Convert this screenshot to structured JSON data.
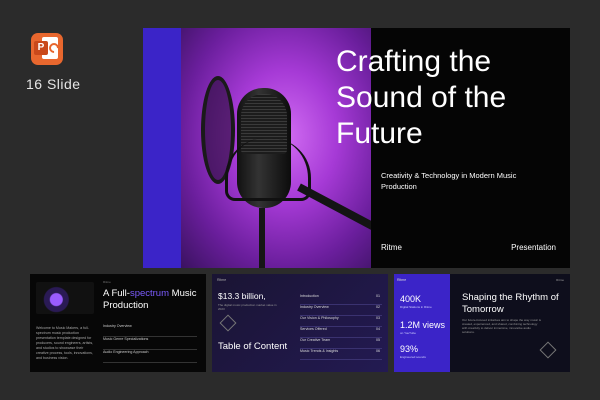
{
  "badge": {
    "count_label": "16 Slide",
    "app_icon": "powerpoint-icon",
    "app_letter": "P"
  },
  "cover": {
    "title": "Crafting the Sound of the Future",
    "subtitle": "Creativity & Technology in Modern Music Production",
    "brand": "Ritme",
    "kind": "Presentation",
    "image": "microphone-photo"
  },
  "slide2": {
    "kicker": "Ritme",
    "heading_prefix": "A Full-",
    "heading_highlight": "spectrum",
    "heading_rest": " Music Production",
    "body": "Welcome to Music Makers, a full-spectrum music production presentation template designed for producers, sound engineers, artists, and studios to showcase their creative process, tools, innovations, and business vision.",
    "items": [
      "Industry Overview",
      "Music Genre Specializations",
      "Audio Engineering Approach"
    ]
  },
  "slide3": {
    "logo": "Ritme",
    "big": "$13.3 billion,",
    "bigsub": "The digital music production market value in 2023",
    "toc": "Table of Content",
    "items": [
      {
        "label": "Introduction",
        "num": "01"
      },
      {
        "label": "Industry Overview",
        "num": "02"
      },
      {
        "label": "Our Vision & Philosophy",
        "num": "03"
      },
      {
        "label": "Services Offered",
        "num": "04"
      },
      {
        "label": "Our Creative Team",
        "num": "05"
      },
      {
        "label": "Music Trends & Insights",
        "num": "06"
      }
    ]
  },
  "slide4": {
    "logo": "Ritme",
    "tag": "Ritme",
    "stats": [
      {
        "value": "400K",
        "label": "Digital Stations in Ritme"
      },
      {
        "value": "1.2M views",
        "label": "on YouTube"
      },
      {
        "value": "93%",
        "label": "Engineered sounds"
      }
    ],
    "heading": "Shaping the Rhythm of Tomorrow",
    "body": "Our future-focused initiatives aim to shape the way music is created, experienced, and shared, combining technology with creativity to deliver immersive, innovative audio solutions."
  },
  "colors": {
    "accent": "#3b24c8",
    "highlight": "#7c5cff",
    "background": "#2b2b2b"
  }
}
